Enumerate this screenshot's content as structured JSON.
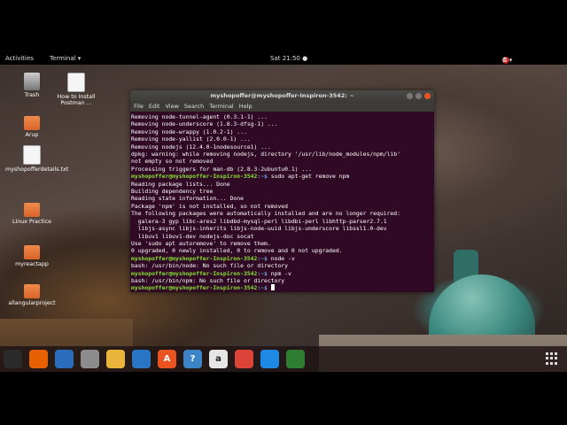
{
  "topbar": {
    "activities": "Activities",
    "app_menu": "Terminal ▾",
    "clock": "Sat 21:50 ●",
    "system_icons": [
      "record-icon",
      "network-icon",
      "volume-icon",
      "power-icon"
    ]
  },
  "desktop_icons": [
    {
      "label": "Trash",
      "icon": "trash-icon"
    },
    {
      "label": "How to Install Postman ...",
      "icon": "document-icon"
    },
    {
      "label": "Arup",
      "icon": "folder-icon"
    },
    {
      "label": "myshopofferdetails.txt",
      "icon": "text-file-icon"
    },
    {
      "label": "Linux Practice",
      "icon": "folder-icon"
    },
    {
      "label": "myreactapp",
      "icon": "folder-icon"
    },
    {
      "label": "allangularproject",
      "icon": "folder-icon"
    }
  ],
  "terminal": {
    "title": "myshopoffer@myshopoffer-Inspiron-3542: ~",
    "menu": [
      "File",
      "Edit",
      "View",
      "Search",
      "Terminal",
      "Help"
    ],
    "prompt_user": "myshopoffer@myshopoffer-Inspiron-3542",
    "prompt_path": ":~$",
    "lines": [
      "Removing node-tunnel-agent (0.3.1-1) ...",
      "Removing node-underscore (1.8.3-dfsg-1) ...",
      "Removing node-wrappy (1.0.2-1) ...",
      "Removing node-yallist (2.0.0-1) ...",
      "Removing nodejs (12.4.0-1nodesource1) ...",
      "dpkg: warning: while removing nodejs, directory '/usr/lib/node_modules/npm/lib'",
      "not empty so not removed",
      "Processing triggers for man-db (2.8.3-2ubuntu0.1) ...",
      "Reading package lists... Done",
      "Building dependency tree",
      "Reading state information... Done",
      "Package 'npm' is not installed, so not removed",
      "The following packages were automatically installed and are no longer required:",
      "  galera-3 gyp libc-ares2 libdbd-mysql-perl libdbi-perl libhttp-parser2.7.1",
      "  libjs-async libjs-inherits libjs-node-uuid libjs-underscore libssl1.0-dev",
      "  libuv1 libuv1-dev nodejs-doc socat",
      "Use 'sudo apt autoremove' to remove them.",
      "0 upgraded, 0 newly installed, 0 to remove and 0 not upgraded.",
      "bash: /usr/bin/node: No such file or directory",
      "bash: /usr/bin/npm: No such file or directory"
    ],
    "commands": [
      "sudo apt-get remove npm",
      "node -v",
      "npm -v",
      ""
    ]
  },
  "dock": {
    "apps": [
      {
        "name": "terminal-icon",
        "color": "#2b2b2b"
      },
      {
        "name": "firefox-icon",
        "color": "#e66000"
      },
      {
        "name": "thunderbird-icon",
        "color": "#2a6ebb"
      },
      {
        "name": "files-icon",
        "color": "#8c8c8c"
      },
      {
        "name": "rhythmbox-icon",
        "color": "#e9b43a"
      },
      {
        "name": "libreoffice-writer-icon",
        "color": "#2a76c6"
      },
      {
        "name": "software-center-icon",
        "color": "#e95420"
      },
      {
        "name": "help-icon",
        "color": "#3d84c6"
      },
      {
        "name": "amazon-icon",
        "color": "#e6e6e6"
      },
      {
        "name": "chrome-icon",
        "color": "#db4437"
      },
      {
        "name": "vscode-icon",
        "color": "#1e88e5"
      },
      {
        "name": "camera-icon",
        "color": "#2e7d32"
      }
    ],
    "dock_labels": [
      "",
      "",
      "",
      "",
      "",
      "",
      "A",
      "?",
      "a",
      "",
      "",
      ""
    ]
  }
}
